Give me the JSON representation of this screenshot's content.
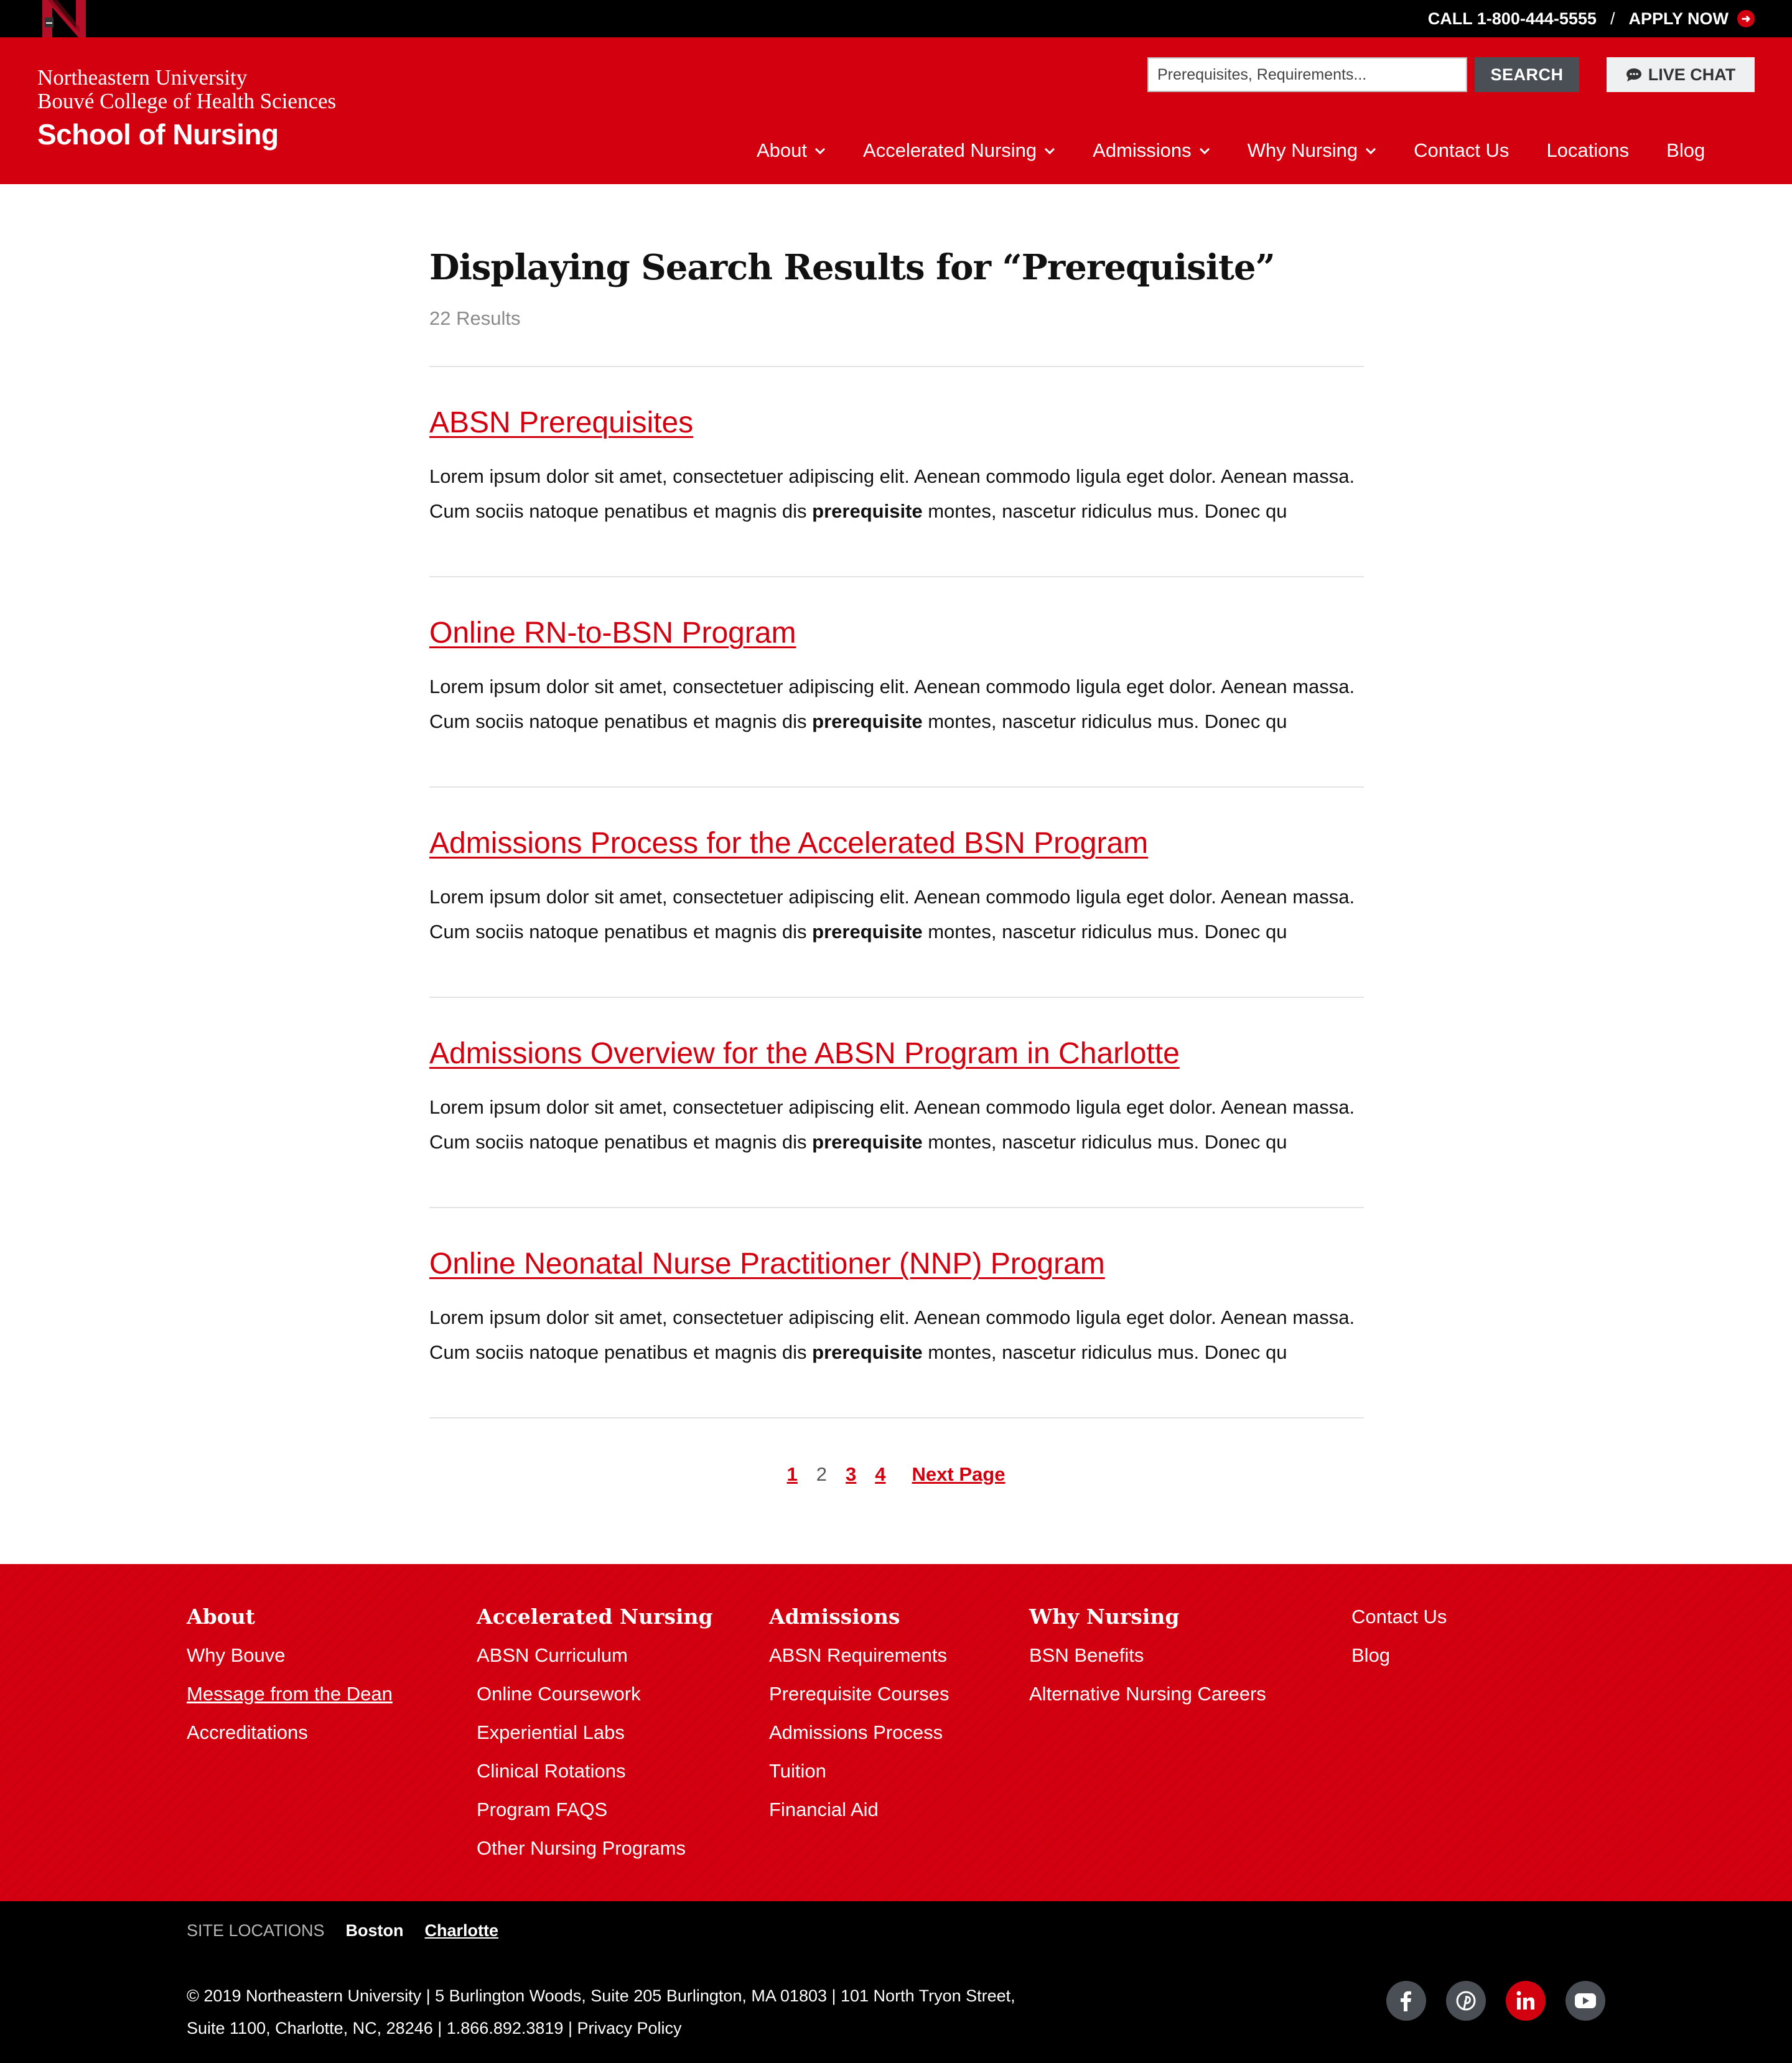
{
  "topbar": {
    "phone": "CALL 1-800-444-5555",
    "separator": "/",
    "apply": "APPLY NOW"
  },
  "brand": {
    "university": "Northeastern University",
    "college": "Bouvé College of Health Sciences",
    "school": "School of Nursing"
  },
  "search": {
    "placeholder": "Prerequisites, Requirements...",
    "button": "SEARCH"
  },
  "chat": {
    "label": "LIVE CHAT",
    "icon": "chat-bubble-icon"
  },
  "nav": [
    {
      "label": "About",
      "dropdown": true
    },
    {
      "label": "Accelerated Nursing",
      "dropdown": true
    },
    {
      "label": "Admissions",
      "dropdown": true
    },
    {
      "label": "Why Nursing",
      "dropdown": true
    },
    {
      "label": "Contact Us",
      "dropdown": false
    },
    {
      "label": "Locations",
      "dropdown": false
    },
    {
      "label": "Blog",
      "dropdown": false
    }
  ],
  "main": {
    "title": "Displaying Search Results for “Prerequisite”",
    "count": "22 Results",
    "results": [
      {
        "title": "ABSN Prerequisites",
        "snippet_before": "Lorem ipsum dolor sit amet, consectetuer adipiscing elit. Aenean commodo ligula eget dolor. Aenean massa. Cum sociis natoque penatibus et magnis dis ",
        "highlight": "prerequisite",
        "snippet_after": " montes, nascetur ridiculus mus. Donec qu"
      },
      {
        "title": "Online RN-to-BSN Program",
        "snippet_before": "Lorem ipsum dolor sit amet, consectetuer adipiscing elit. Aenean commodo ligula eget dolor. Aenean massa. Cum sociis natoque penatibus et magnis dis ",
        "highlight": "prerequisite",
        "snippet_after": " montes, nascetur ridiculus mus. Donec qu"
      },
      {
        "title": "Admissions Process for the Accelerated BSN Program",
        "snippet_before": "Lorem ipsum dolor sit amet, consectetuer adipiscing elit. Aenean commodo ligula eget dolor. Aenean massa. Cum sociis natoque penatibus et magnis dis ",
        "highlight": "prerequisite",
        "snippet_after": " montes, nascetur ridiculus mus. Donec qu"
      },
      {
        "title": "Admissions Overview for the ABSN Program in Charlotte",
        "snippet_before": "Lorem ipsum dolor sit amet, consectetuer adipiscing elit. Aenean commodo ligula eget dolor. Aenean massa. Cum sociis natoque penatibus et magnis dis ",
        "highlight": "prerequisite",
        "snippet_after": " montes, nascetur ridiculus mus. Donec qu"
      },
      {
        "title": "Online Neonatal Nurse Practitioner (NNP) Program",
        "snippet_before": "Lorem ipsum dolor sit amet, consectetuer adipiscing elit. Aenean commodo ligula eget dolor. Aenean massa. Cum sociis natoque penatibus et magnis dis ",
        "highlight": "prerequisite",
        "snippet_after": " montes, nascetur ridiculus mus. Donec qu"
      }
    ]
  },
  "pagination": {
    "pages": [
      "1",
      "2",
      "3",
      "4"
    ],
    "current": "2",
    "next": "Next Page"
  },
  "footer": {
    "columns": [
      {
        "heading": "About",
        "links": [
          "Why Bouve",
          "Message from the Dean",
          "Accreditations"
        ]
      },
      {
        "heading": "Accelerated Nursing",
        "links": [
          "ABSN Curriculum",
          "Online Coursework",
          "Experiential Labs",
          "Clinical Rotations",
          "Program FAQS",
          "Other Nursing Programs"
        ]
      },
      {
        "heading": "Admissions",
        "links": [
          "ABSN Requirements",
          "Prerequisite Courses",
          "Admissions Process",
          "Tuition",
          "Financial Aid"
        ]
      },
      {
        "heading": "Why Nursing",
        "links": [
          "BSN Benefits",
          "Alternative Nursing Careers"
        ]
      },
      {
        "heading": "",
        "links": [
          "Contact Us",
          "Blog"
        ]
      }
    ],
    "site_locations_label": "SITE LOCATIONS",
    "locations": [
      "Boston",
      "Charlotte"
    ],
    "copyright": "© 2019 Northeastern University | 5 Burlington Woods, Suite 205 Burlington, MA 01803 | 101 North Tryon Street, Suite 1100, Charlotte, NC, 28246 | 1.866.892.3819 | Privacy Policy",
    "social": [
      "facebook-icon",
      "pinterest-icon",
      "linkedin-icon",
      "youtube-icon"
    ]
  },
  "colors": {
    "brand_red": "#d30010",
    "black": "#000000",
    "button_gray": "#4a4f55"
  }
}
